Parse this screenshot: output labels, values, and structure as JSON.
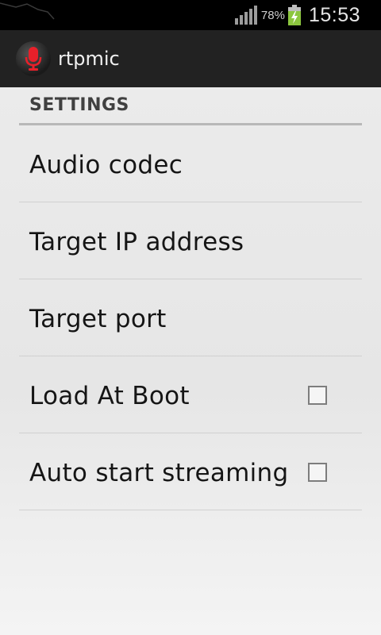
{
  "status_bar": {
    "battery_percent": "78%",
    "time": "15:53",
    "icons": [
      "signal-icon",
      "battery-charging-icon"
    ]
  },
  "action_bar": {
    "app_title": "rtpmic",
    "app_icon": "microphone-icon",
    "icon_color": "#e8202a"
  },
  "settings": {
    "section_header": "SETTINGS",
    "items": [
      {
        "label": "Audio codec",
        "has_checkbox": false
      },
      {
        "label": "Target IP address",
        "has_checkbox": false
      },
      {
        "label": "Target port",
        "has_checkbox": false
      },
      {
        "label": "Load At Boot",
        "has_checkbox": true,
        "checked": false
      },
      {
        "label": "Auto start streaming",
        "has_checkbox": true,
        "checked": false
      }
    ]
  }
}
